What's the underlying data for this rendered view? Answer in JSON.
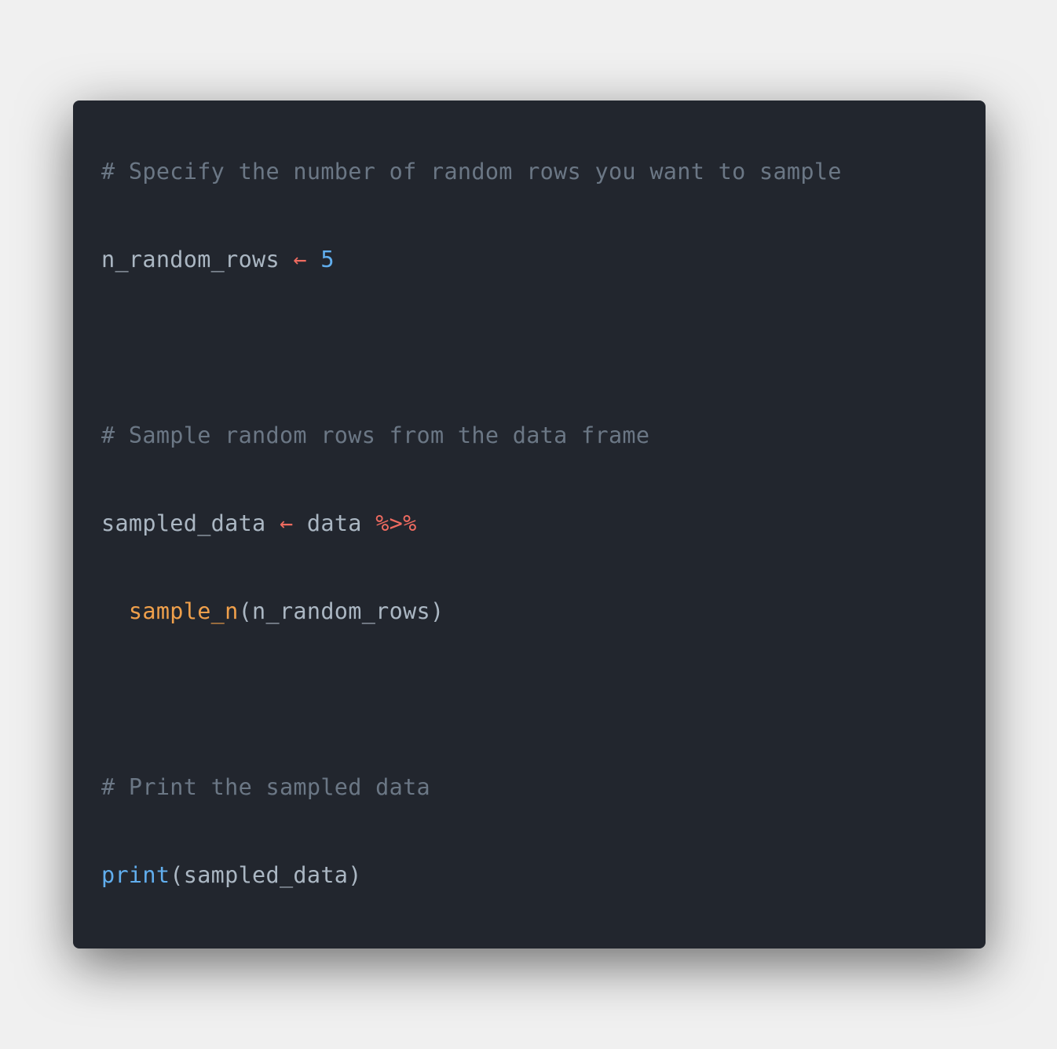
{
  "colors": {
    "page_background": "#f0f0f0",
    "card_background": "#22262e",
    "comment": "#6b7785",
    "text": "#abb7c3",
    "operator": "#ef6b60",
    "number": "#61aeee",
    "function_call": "#f0a04b",
    "builtin": "#61aeee"
  },
  "code": {
    "language": "R",
    "lines": [
      {
        "tokens": [
          {
            "type": "comment",
            "text": "# Specify the number of random rows you want to sample"
          }
        ]
      },
      {
        "tokens": []
      },
      {
        "tokens": [
          {
            "type": "plain",
            "text": "n_random_rows "
          },
          {
            "type": "operator",
            "text": "←"
          },
          {
            "type": "plain",
            "text": " "
          },
          {
            "type": "number",
            "text": "5"
          }
        ]
      },
      {
        "tokens": []
      },
      {
        "tokens": []
      },
      {
        "tokens": []
      },
      {
        "tokens": [
          {
            "type": "comment",
            "text": "# Sample random rows from the data frame"
          }
        ]
      },
      {
        "tokens": []
      },
      {
        "tokens": [
          {
            "type": "plain",
            "text": "sampled_data "
          },
          {
            "type": "operator",
            "text": "←"
          },
          {
            "type": "plain",
            "text": " data "
          },
          {
            "type": "operator",
            "text": "%>%"
          }
        ]
      },
      {
        "tokens": []
      },
      {
        "tokens": [
          {
            "type": "plain",
            "text": "  "
          },
          {
            "type": "function_call",
            "text": "sample_n"
          },
          {
            "type": "plain",
            "text": "(n_random_rows)"
          }
        ]
      },
      {
        "tokens": []
      },
      {
        "tokens": []
      },
      {
        "tokens": []
      },
      {
        "tokens": [
          {
            "type": "comment",
            "text": "# Print the sampled data"
          }
        ]
      },
      {
        "tokens": []
      },
      {
        "tokens": [
          {
            "type": "builtin",
            "text": "print"
          },
          {
            "type": "plain",
            "text": "(sampled_data)"
          }
        ]
      }
    ]
  }
}
